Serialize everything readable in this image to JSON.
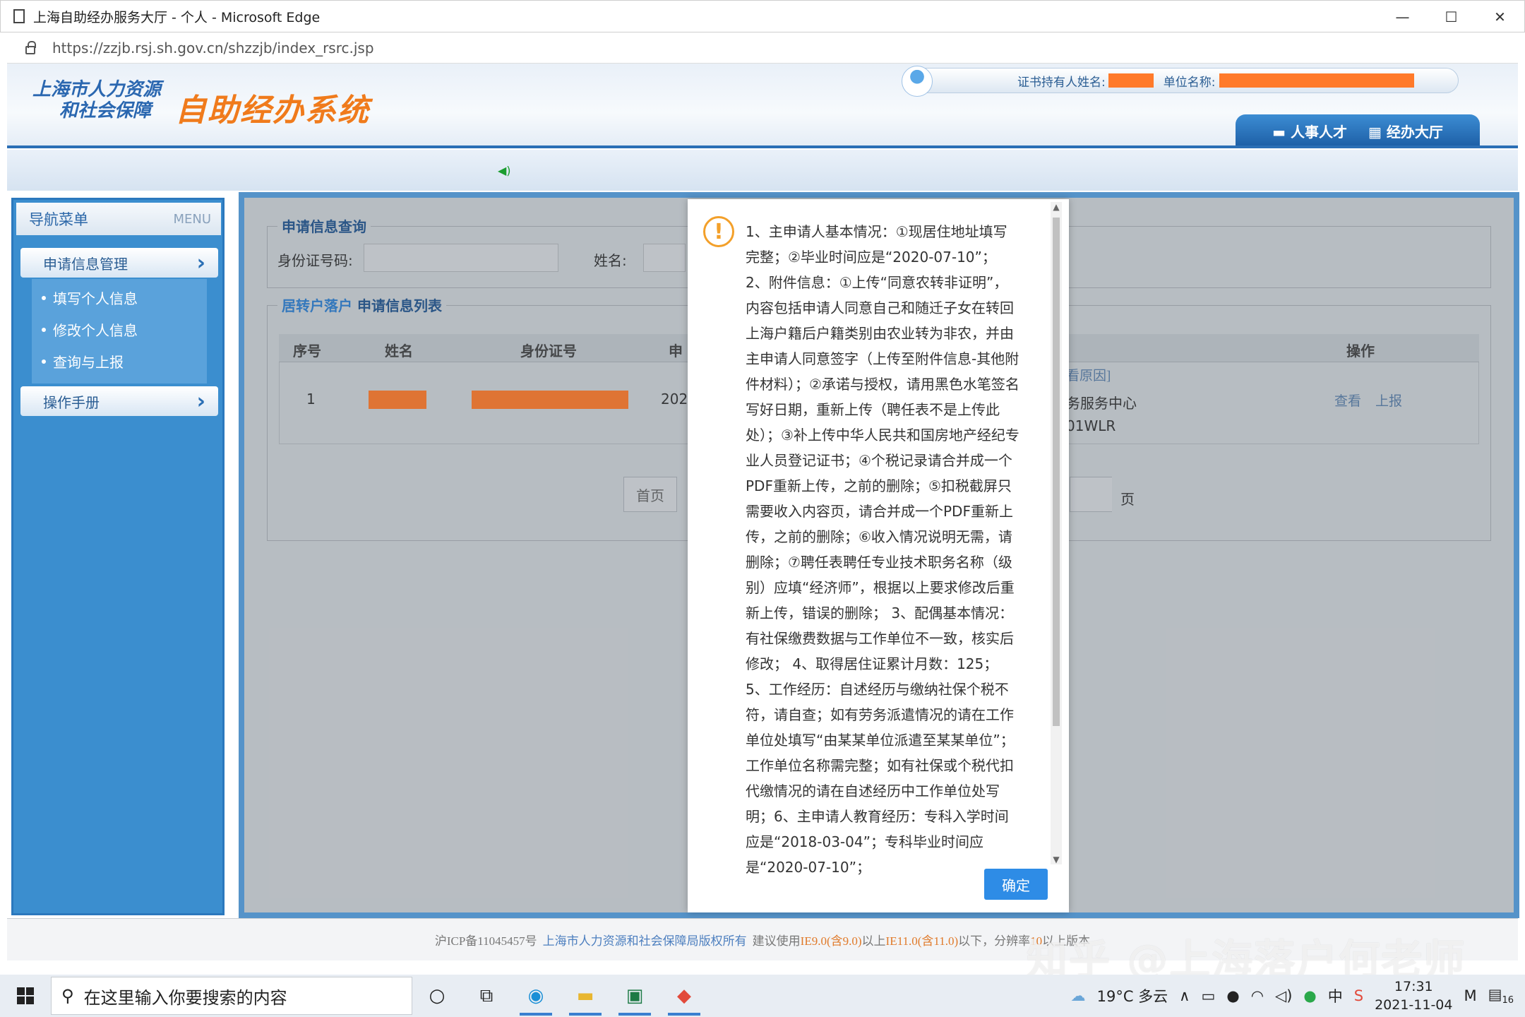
{
  "browser": {
    "title": "上海自助经办服务大厅 - 个人 - Microsoft Edge",
    "url": "https://zzjb.rsj.sh.gov.cn/shzzjb/index_rsrc.jsp",
    "controls": {
      "minimize": "—",
      "maximize": "☐",
      "close": "✕"
    }
  },
  "header": {
    "logo_line1": "上海市人力资源",
    "logo_line2": "和社会保障",
    "logo_system": "自助经办系统",
    "holder_label": "证书持有人姓名:",
    "unit_label": "单位名称:",
    "tabs": [
      "人事人才",
      "经办大厅"
    ]
  },
  "sidebar": {
    "title": "导航菜单",
    "title_en": "MENU",
    "items": [
      {
        "label": "申请信息管理",
        "children": [
          "填写个人信息",
          "修改个人信息",
          "查询与上报"
        ]
      },
      {
        "label": "操作手册"
      }
    ]
  },
  "query": {
    "legend": "申请信息查询",
    "id_label": "身份证号码:",
    "name_label": "姓名:"
  },
  "list": {
    "legend_prefix": "居转户落户",
    "legend_suffix": "申请信息列表",
    "columns": [
      "序号",
      "姓名",
      "身份证号",
      "申",
      "操作"
    ],
    "row": {
      "index": "1",
      "date_partial": "202",
      "reason_link": "看原因]",
      "center": "务服务中心",
      "code": "01WLR",
      "action_view": "查看",
      "action_report": "上报"
    },
    "pager": {
      "first": "首页",
      "last_suffix": "页"
    }
  },
  "dialog": {
    "message": "1、主申请人基本情况：①现居住地址填写完整；②毕业时间应是“2020-07-10”； 2、附件信息：①上传“同意农转非证明”，内容包括申请人同意自己和随迁子女在转回上海户籍后户籍类别由农业转为非农，并由主申请人同意签字（上传至附件信息-其他附件材料）；②承诺与授权，请用黑色水笔签名写好日期，重新上传（聘任表不是上传此处）；③补上传中华人民共和国房地产经纪专业人员登记证书；④个税记录请合并成一个PDF重新上传，之前的删除；⑤扣税截屏只需要收入内容页，请合并成一个PDF重新上传，之前的删除；⑥收入情况说明无需，请删除；⑦聘任表聘任专业技术职务名称（级别）应填“经济师”，根据以上要求修改后重新上传，错误的删除； 3、配偶基本情况：有社保缴费数据与工作单位不一致，核实后修改； 4、取得居住证累计月数：125； 5、工作经历：自述经历与缴纳社保个税不符，请自查；如有劳务派遣情况的请在工作单位处填写“由某某单位派遣至某某单位”；工作单位名称需完整；如有社保或个税代扣代缴情况的请在自述经历中工作单位处写明；6、主申请人教育经历：专科入学时间应是“2018-03-04”；专科毕业时间应是“2020-07-10”；",
    "ok": "确定"
  },
  "footer": {
    "icp": "沪ICP备11045457号",
    "copyright": "上海市人力资源和社会保障局版权所有",
    "suggest": "建议使用",
    "ie9": "IE9.0(含9.0)",
    "above": "以上",
    "ie11": "IE11.0(含11.0)",
    "below": "以下，分辨率",
    "res": "10",
    "tail": "以上版本"
  },
  "watermark": "知乎 @上海落户何老师",
  "taskbar": {
    "search_placeholder": "在这里输入你要搜索的内容",
    "weather": "19°C 多云",
    "ime": "中",
    "time": "17:31",
    "date": "2021-11-04",
    "notifications": "16"
  },
  "colors": {
    "redaction": "#ff7a2a",
    "accent": "#2b6fb5",
    "ok_button": "#2e8ce6",
    "warning": "#f3a02a"
  }
}
